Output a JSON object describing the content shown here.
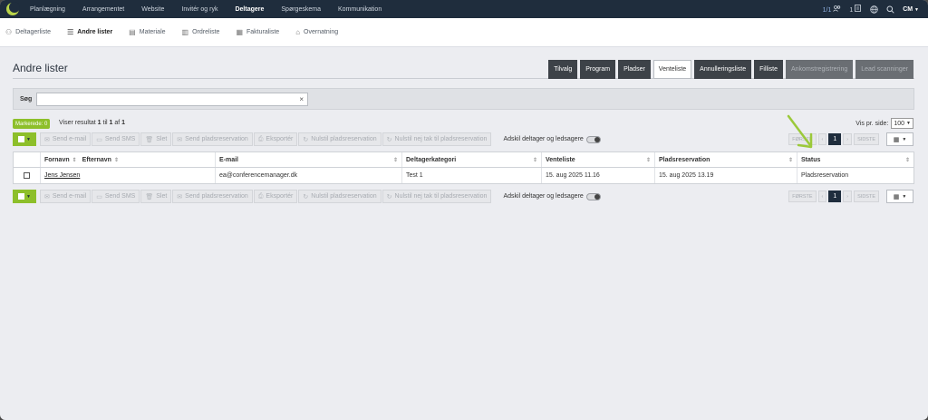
{
  "nav": {
    "items": [
      "Planlægning",
      "Arrangementet",
      "Website",
      "Invitér og ryk",
      "Deltagere",
      "Spørgeskema",
      "Kommunikation"
    ],
    "active": "Deltagere",
    "counter": "1/1",
    "badge_count": "1",
    "user_initials": "CM",
    "icons": [
      "people-icon",
      "list-badge-icon",
      "globe-icon",
      "search-icon"
    ]
  },
  "subnav": {
    "items": [
      {
        "label": "Deltagerliste",
        "icon": "people-outline-icon"
      },
      {
        "label": "Andre lister",
        "icon": "list-icon"
      },
      {
        "label": "Materiale",
        "icon": "document-icon"
      },
      {
        "label": "Ordreliste",
        "icon": "clipboard-icon"
      },
      {
        "label": "Fakturaliste",
        "icon": "invoice-icon"
      },
      {
        "label": "Overnatning",
        "icon": "bed-icon"
      }
    ],
    "active": "Andre lister"
  },
  "page": {
    "title": "Andre lister",
    "tabs": [
      {
        "label": "Tilvalg",
        "state": "normal"
      },
      {
        "label": "Program",
        "state": "normal"
      },
      {
        "label": "Pladser",
        "state": "normal"
      },
      {
        "label": "Venteliste",
        "state": "active"
      },
      {
        "label": "Annulleringsliste",
        "state": "normal"
      },
      {
        "label": "Filliste",
        "state": "normal"
      },
      {
        "label": "Ankomstregistrering",
        "state": "disabled"
      },
      {
        "label": "Lead scanninger",
        "state": "disabled"
      }
    ]
  },
  "search": {
    "label": "Søg",
    "value": "",
    "placeholder": "",
    "clear": "×"
  },
  "selection": {
    "markerede": "Markerede: 0",
    "result_prefix": "Viser resultat ",
    "result_from": "1",
    "result_mid1": " til ",
    "result_to": "1",
    "result_mid2": " af ",
    "result_total": "1"
  },
  "per_page": {
    "label": "Vis pr. side:",
    "value": "100"
  },
  "actions": [
    {
      "label": "Send e-mail",
      "icon": "envelope-icon"
    },
    {
      "label": "Send SMS",
      "icon": "sms-icon"
    },
    {
      "label": "Slet",
      "icon": "trash-icon"
    },
    {
      "label": "Send pladsreservation",
      "icon": "envelope-icon"
    },
    {
      "label": "Eksportér",
      "icon": "export-icon"
    },
    {
      "label": "Nulstil pladsreservation",
      "icon": "refresh-icon"
    },
    {
      "label": "Nulstil nej tak til pladsreservation",
      "icon": "refresh-icon"
    }
  ],
  "toggle": {
    "label": "Adskil deltager og ledsagere"
  },
  "pager": {
    "first": "FØRSTE",
    "prev": "‹",
    "current": "1",
    "next": "›",
    "last": "SIDSTE"
  },
  "table": {
    "columns": [
      "Fornavn",
      "Efternavn",
      "E-mail",
      "Deltagerkategori",
      "Venteliste",
      "Pladsreservation",
      "Status"
    ],
    "rows": [
      {
        "name": "Jens Jensen",
        "email": "ea@conferencemanager.dk",
        "kategori": "Test 1",
        "venteliste": "15. aug 2025 11.16",
        "pladsreservation": "15. aug 2025 13.19",
        "status": "Pladsreservation"
      }
    ]
  },
  "colors": {
    "nav_bg": "#1f2d3d",
    "accent_green": "#8dbf2a",
    "tab_dark": "#3d4248",
    "arrow": "#9bc93a"
  }
}
